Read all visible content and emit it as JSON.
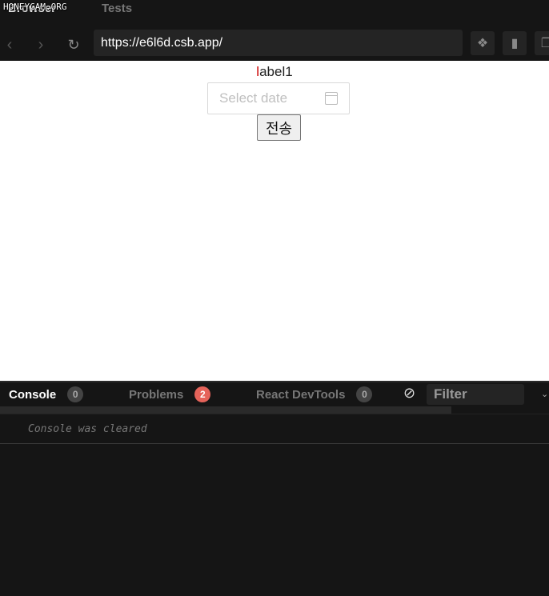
{
  "watermark": "HONEYCAM.ORG",
  "tabs": {
    "browser": "Browser",
    "tests": "Tests"
  },
  "navbar": {
    "url": "https://e6l6d.csb.app/"
  },
  "page": {
    "label_first": "l",
    "label_rest": "abel1",
    "date_placeholder": "Select date",
    "submit": "전송"
  },
  "devtools": {
    "console": "Console",
    "console_count": "0",
    "problems": "Problems",
    "problems_count": "2",
    "react": "React DevTools",
    "react_count": "0",
    "filter": "Filter",
    "message": "Console was cleared"
  }
}
